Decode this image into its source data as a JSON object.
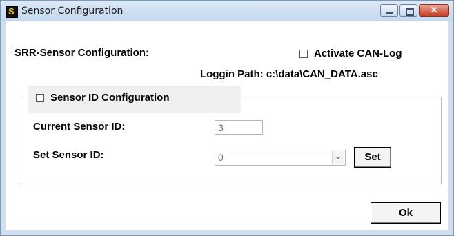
{
  "window": {
    "title": "Sensor Configuration"
  },
  "dialog": {
    "heading": "SRR-Sensor Configuration:",
    "can_log_label": "Activate CAN-Log",
    "log_path": "Loggin Path: c:\\data\\CAN_DATA.asc",
    "group": {
      "title": "Sensor ID Configuration",
      "current_id_label": "Current Sensor ID:",
      "current_id_value": "3",
      "set_id_label": "Set Sensor ID:",
      "set_id_value": "0",
      "set_button": "Set"
    },
    "ok_button": "Ok"
  }
}
